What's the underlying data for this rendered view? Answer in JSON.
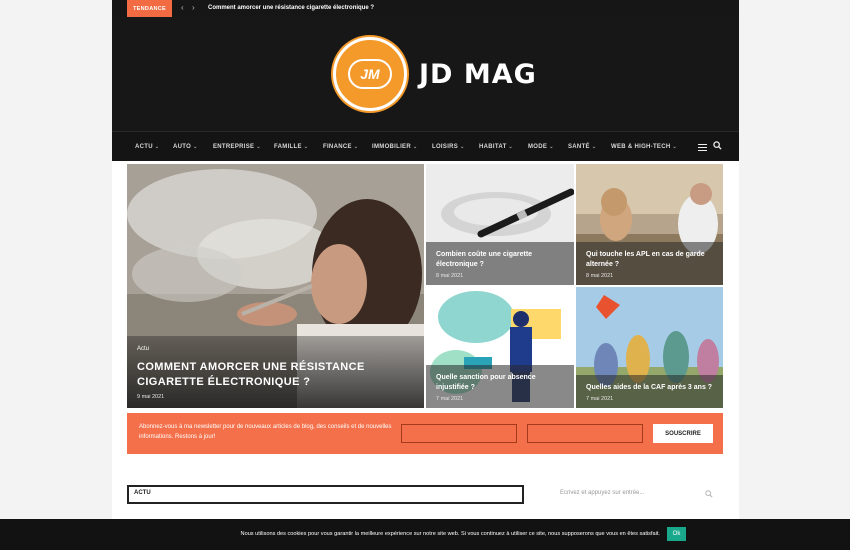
{
  "topbar": {
    "badge": "TENDANCE",
    "prev_icon": "chevron-left-icon",
    "next_icon": "chevron-right-icon",
    "headline": "Comment amorcer une résistance cigarette électronique ?"
  },
  "header": {
    "logo_mark": "JM",
    "site_name": "JD MAG",
    "accent": "#f39a2b"
  },
  "nav": {
    "items": [
      {
        "label": "ACTU"
      },
      {
        "label": "AUTO"
      },
      {
        "label": "ENTREPRISE"
      },
      {
        "label": "FAMILLE"
      },
      {
        "label": "FINANCE"
      },
      {
        "label": "IMMOBILIER"
      },
      {
        "label": "LOISIRS"
      },
      {
        "label": "HABITAT"
      },
      {
        "label": "MODE"
      },
      {
        "label": "SANTÉ"
      },
      {
        "label": "WEB & HIGH-TECH"
      }
    ],
    "menu_icon": "hamburger-menu-icon",
    "search_icon": "search-icon"
  },
  "featured": {
    "main": {
      "category": "Actu",
      "title": "COMMENT AMORCER UNE RÉSISTANCE CIGARETTE ÉLECTRONIQUE ?",
      "date": "9 mai 2021"
    },
    "posts": [
      {
        "title": "Combien coûte une cigarette électronique ?",
        "date": "8 mai 2021"
      },
      {
        "title": "Qui touche les APL en cas de garde alternée ?",
        "date": "8 mai 2021"
      },
      {
        "title": "Quelle sanction pour absence injustifiée ?",
        "date": "7 mai 2021"
      },
      {
        "title": "Quelles aides de la CAF après 3 ans ?",
        "date": "7 mai 2021"
      }
    ]
  },
  "newsletter": {
    "text": "Abonnez-vous à ma newsletter pour de nouveaux articles de blog, des conseils et de nouvelles informations. Restons à jour!",
    "name_placeholder": "",
    "email_placeholder": "",
    "button": "SOUSCRIRE",
    "color": "#f3704a"
  },
  "section": {
    "label": "ACTU"
  },
  "sidebar_search": {
    "placeholder": "Ecrivez et appuyez sur entrée...",
    "icon": "search-icon"
  },
  "cookie": {
    "text": "Nous utilisons des cookies pour vous garantir la meilleure expérience sur notre site web. Si vous continuez à utiliser ce site, nous supposerons que vous en êtes satisfait.",
    "ok": "Ok"
  }
}
